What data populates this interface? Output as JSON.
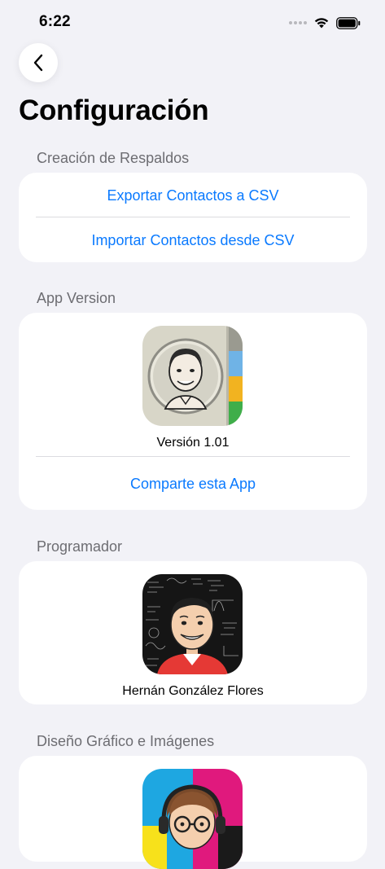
{
  "status": {
    "time": "6:22"
  },
  "nav": {
    "back_icon": "chevron-left-icon",
    "title": "Configuración"
  },
  "sections": {
    "backup": {
      "header": "Creación de Respaldos",
      "export_label": "Exportar Contactos a CSV",
      "import_label": "Importar Contactos desde CSV"
    },
    "version": {
      "header": "App Version",
      "version_text": "Versión 1.01",
      "share_label": "Comparte esta App"
    },
    "programmer": {
      "header": "Programador",
      "name": "Hernán González Flores"
    },
    "design": {
      "header": "Diseño Gráfico e Imágenes"
    }
  },
  "colors": {
    "background": "#f2f2f7",
    "accent": "#0a7aff",
    "section_header": "#6d6d72"
  }
}
